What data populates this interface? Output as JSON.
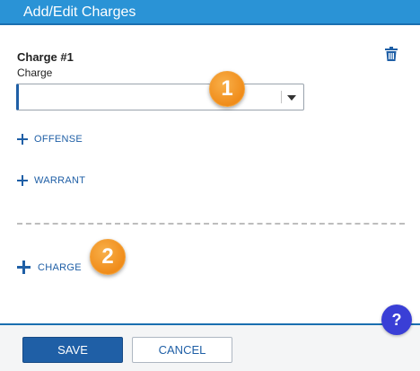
{
  "header": {
    "title": "Add/Edit Charges"
  },
  "charge": {
    "title": "Charge #1",
    "label": "Charge",
    "selected_value": "",
    "delete_icon": "trash-icon"
  },
  "links": {
    "offense": "OFFENSE",
    "warrant": "WARRANT",
    "add_charge": "CHARGE"
  },
  "callouts": {
    "one": "1",
    "two": "2"
  },
  "footer": {
    "save_label": "SAVE",
    "cancel_label": "CANCEL"
  },
  "help": {
    "label": "?"
  },
  "colors": {
    "header_bg": "#2a93d6",
    "primary": "#1f5fa6",
    "callout": "#f08c1a",
    "help_bg": "#3a3fd6"
  }
}
